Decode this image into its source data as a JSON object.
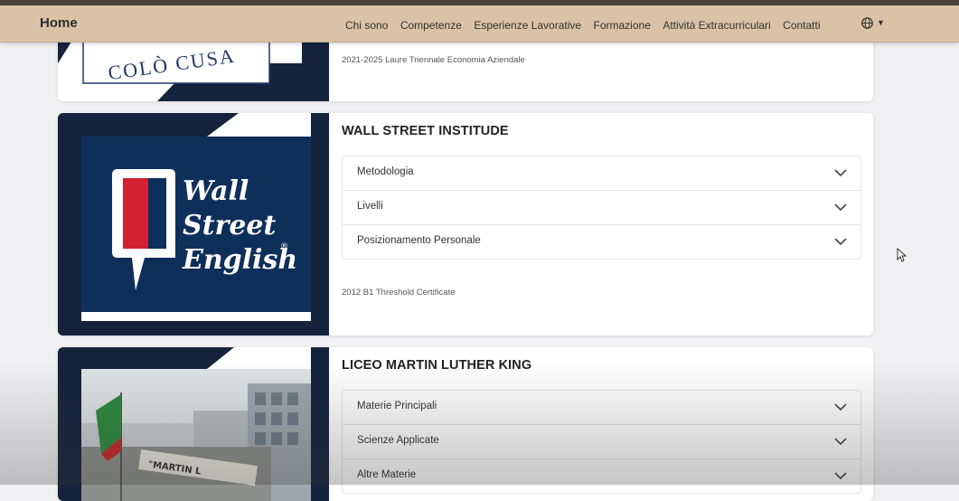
{
  "nav": {
    "brand": "Home",
    "links": [
      "Chi sono",
      "Competenze",
      "Esperienze Lavorative",
      "Formazione",
      "Attività Extracurriculari",
      "Contatti"
    ],
    "lang_icon": "globe-icon"
  },
  "cards": [
    {
      "logo_text": "COLÒ CUSA",
      "note": "2021-2025 Laure Triennale Economia Aziendale"
    },
    {
      "title": "WALL STREET INSTITUDE",
      "logo_lines": [
        "Wall",
        "Street",
        "English"
      ],
      "logo_mark": "®",
      "accordion": [
        "Metodologia",
        "Livelli",
        "Posizionamento Personale"
      ],
      "note": "2012 B1 Threshold Certificate"
    },
    {
      "title": "LICEO MARTIN LUTHER KING",
      "sign_text": "\"MARTIN L",
      "accordion": [
        "Materie Principali",
        "Scienze Applicate",
        "Altre Materie"
      ]
    }
  ],
  "colors": {
    "navbar": "#d9c2a5",
    "card_dark": "#15243c",
    "wse_blue": "#0f2f5b",
    "wse_red": "#d32030"
  }
}
